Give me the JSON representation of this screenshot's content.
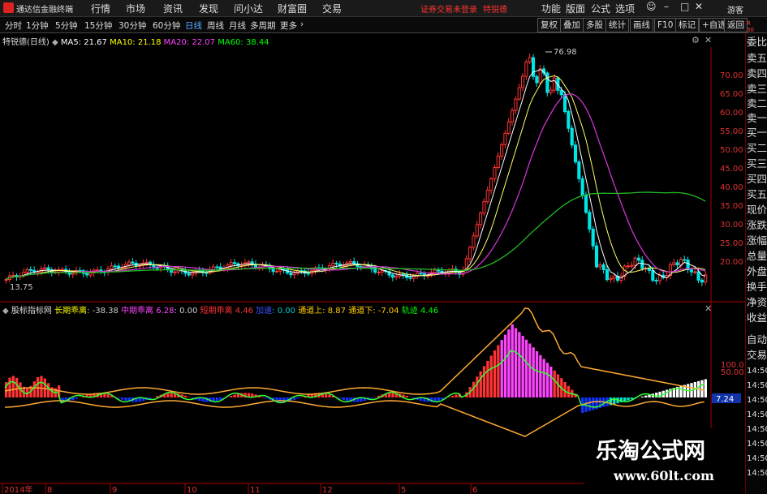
{
  "menubar": {
    "app_title": "通达信金融终端",
    "menus": [
      "行情",
      "市场",
      "资讯",
      "发现",
      "问小达",
      "财富圈",
      "交易"
    ],
    "warning": "证券交易未登录",
    "stock_name": "特锐德",
    "right_items": [
      "功能",
      "版面",
      "公式",
      "选项"
    ],
    "guest": "游客"
  },
  "toolbar": {
    "periods": [
      "分时",
      "1分钟",
      "5分钟",
      "15分钟",
      "30分钟",
      "60分钟",
      "日线",
      "周线",
      "月线",
      "多周期",
      "更多"
    ],
    "active_period": "日线",
    "right_buttons": [
      "复权",
      "叠加",
      "多股",
      "统计",
      "画线",
      "F10",
      "标记",
      "+自选",
      "返回"
    ]
  },
  "kline": {
    "title": "特锐德(日线)",
    "ma": [
      {
        "label": "MA5: 21.67",
        "color": "#ffffff"
      },
      {
        "label": "MA10: 21.18",
        "color": "#ffff00"
      },
      {
        "label": "MA20: 22.07",
        "color": "#ff44ff"
      },
      {
        "label": "MA60: 38.44",
        "color": "#00ff00"
      }
    ],
    "price_ticks": [
      "70.00",
      "65.00",
      "60.00",
      "55.00",
      "50.00",
      "45.00",
      "40.00",
      "35.00",
      "30.00",
      "25.00",
      "20.00"
    ],
    "high_label": "76.98",
    "low_label": "13.75"
  },
  "indicator": {
    "title": "股标指标网",
    "items": [
      {
        "text": "长期乖离",
        "color": "#ffff00"
      },
      {
        "text": ": -38.38",
        "color": "#cccccc"
      },
      {
        "text": "中期乖离",
        "color": "#ff44ff"
      },
      {
        "text": "6.28",
        "color": "#ff44ff"
      },
      {
        "text": ": 0.00",
        "color": "#cccccc"
      },
      {
        "text": "短期乖离",
        "color": "#ff3333"
      },
      {
        "text": "4.46",
        "color": "#ff3333"
      },
      {
        "text": "加速",
        "color": "#3355ff"
      },
      {
        "text": ": 0.00",
        "color": "#00cccc"
      },
      {
        "text": "通道上: 8.87",
        "color": "#ffcc00"
      },
      {
        "text": "通道下: -7.04",
        "color": "#ffcc00"
      },
      {
        "text": "轨迹",
        "color": "#00ff00"
      },
      {
        "text": "4.46",
        "color": "#00ff00"
      }
    ],
    "ticks": [
      "100.0",
      "50.00",
      "7.24"
    ]
  },
  "xaxis": [
    "2014年",
    "8",
    "9",
    "10",
    "11",
    "12",
    "5",
    "6"
  ],
  "right_panel": [
    "委比",
    "卖五",
    "卖四",
    "卖三",
    "卖二",
    "卖一",
    "买一",
    "买二",
    "买三",
    "买四",
    "买五",
    "现价",
    "涨跌",
    "涨幅",
    "总量",
    "外盘",
    "换手",
    "净资",
    "收益",
    "自动",
    "交易",
    "14:50",
    "14:50",
    "14:50",
    "14:50",
    "14:50",
    "14:50",
    "14:50",
    "14:50"
  ],
  "watermark": {
    "title": "乐淘公式网",
    "url": "www.60lt.com"
  },
  "colors": {
    "up": "#ff3333",
    "down": "#00e5e5",
    "ma5": "#ffffff",
    "ma10": "#ffff00",
    "ma20": "#ff44ff",
    "ma60": "#00ff00"
  }
}
